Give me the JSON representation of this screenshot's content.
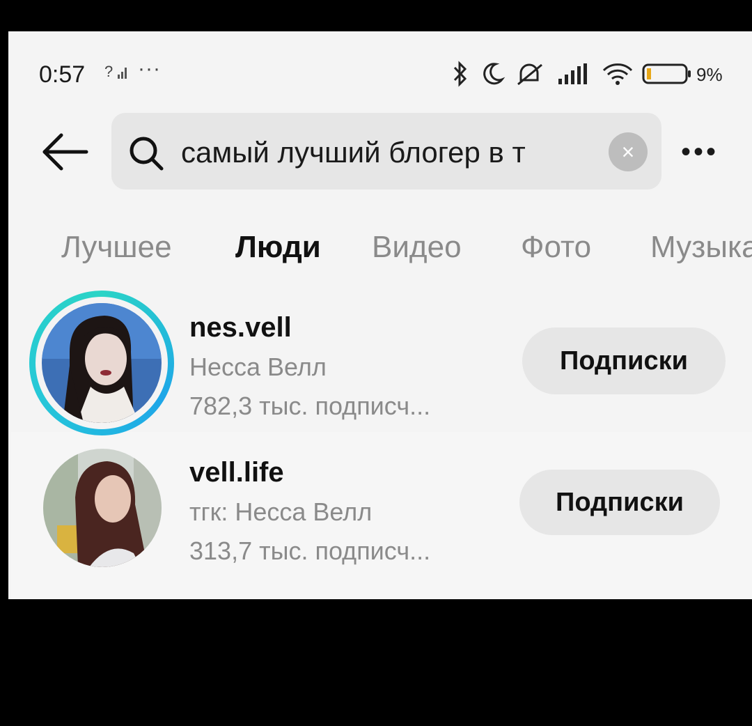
{
  "status_bar": {
    "time": "0:57",
    "sim_indicator": "?",
    "more_dots": "···",
    "battery": "9%",
    "icons": [
      "bluetooth-icon",
      "moon-icon",
      "mute-icon",
      "cell-signal-icon",
      "wifi-icon",
      "battery-icon"
    ]
  },
  "search": {
    "query": "самый лучший блогер в т",
    "clear_symbol": "×",
    "more_symbol": "•••"
  },
  "tabs": [
    {
      "label": "Лучшее",
      "active": false
    },
    {
      "label": "Люди",
      "active": true
    },
    {
      "label": "Видео",
      "active": false
    },
    {
      "label": "Фото",
      "active": false
    },
    {
      "label": "Музыка",
      "active": false
    }
  ],
  "results": [
    {
      "username": "nes.vell",
      "full_name": "Несса Велл",
      "followers": "782,3 тыс. подписч...",
      "button": "Подписки",
      "has_story": true
    },
    {
      "username": "vell.life",
      "full_name": "тгк: Несса Велл",
      "followers": "313,7 тыс. подписч...",
      "button": "Подписки",
      "has_story": false
    }
  ],
  "colors": {
    "background": "#f4f4f4",
    "search_bg": "#e6e6e6",
    "story_ring": "#1ea6e8",
    "muted_text": "#8a8a8a"
  }
}
